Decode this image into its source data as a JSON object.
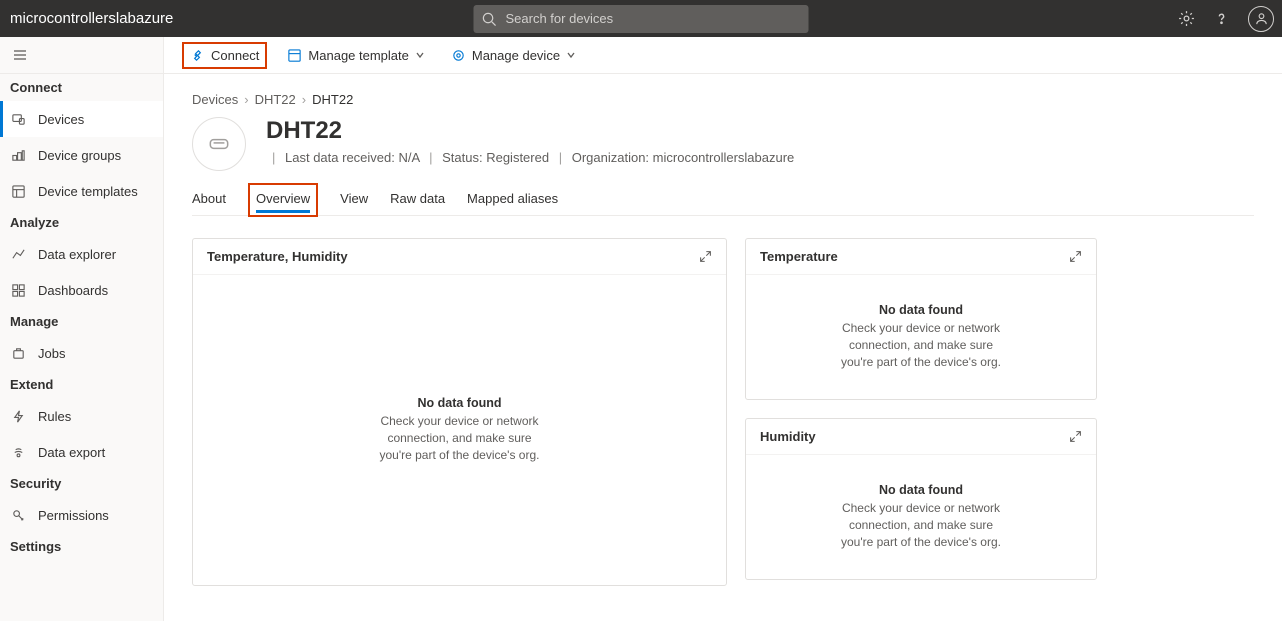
{
  "header": {
    "app_title": "microcontrollerslabazure",
    "search_placeholder": "Search for devices"
  },
  "sidebar": {
    "sections": {
      "connect": {
        "heading": "Connect",
        "items": [
          "Devices",
          "Device groups",
          "Device templates"
        ]
      },
      "analyze": {
        "heading": "Analyze",
        "items": [
          "Data explorer",
          "Dashboards"
        ]
      },
      "manage": {
        "heading": "Manage",
        "items": [
          "Jobs"
        ]
      },
      "extend": {
        "heading": "Extend",
        "items": [
          "Rules",
          "Data export"
        ]
      },
      "security": {
        "heading": "Security",
        "items": [
          "Permissions"
        ]
      },
      "settings": {
        "heading": "Settings"
      }
    }
  },
  "toolbar": {
    "connect_label": "Connect",
    "manage_template_label": "Manage template",
    "manage_device_label": "Manage device"
  },
  "breadcrumb": {
    "root": "Devices",
    "mid": "DHT22",
    "leaf": "DHT22"
  },
  "device": {
    "title": "DHT22",
    "last_data_label": "Last data received:",
    "last_data_value": "N/A",
    "status_label": "Status:",
    "status_value": "Registered",
    "org_label": "Organization:",
    "org_value": "microcontrollerslabazure"
  },
  "tabs": {
    "about": "About",
    "overview": "Overview",
    "view": "View",
    "raw_data": "Raw data",
    "mapped_aliases": "Mapped aliases"
  },
  "cards": {
    "combined": {
      "title": "Temperature, Humidity"
    },
    "temp": {
      "title": "Temperature"
    },
    "humidity": {
      "title": "Humidity"
    },
    "nodata_title": "No data found",
    "nodata_desc": "Check your device or network connection, and make sure you're part of the device's org."
  }
}
